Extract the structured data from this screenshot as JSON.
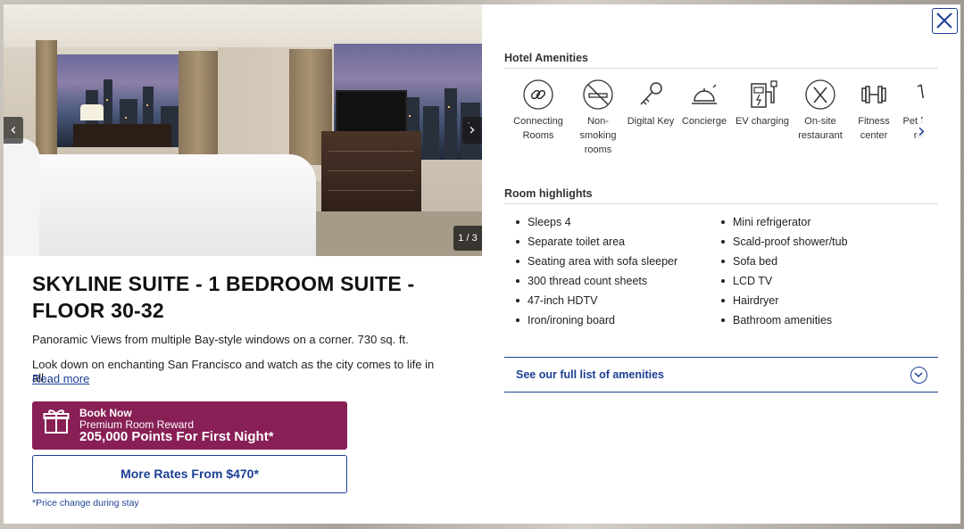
{
  "photo": {
    "counter": "1 / 3",
    "prev_glyph": "‹",
    "next_glyph": "›"
  },
  "room": {
    "title": "SKYLINE SUITE - 1 BEDROOM SUITE - FLOOR 30-32",
    "subtitle": "Panoramic Views from multiple Bay-style windows on a corner. 730 sq. ft.",
    "description": "Look down on enchanting San Francisco and watch as the city comes to life in all...",
    "read_more": "Read more"
  },
  "booking": {
    "line1": "Book Now",
    "line2": "Premium Room Reward",
    "line3": "205,000 Points For First Night*",
    "brand_color": "#882056"
  },
  "rates": {
    "label": "More Rates From $470*",
    "note": "*Price change during stay"
  },
  "amenities": {
    "heading": "Hotel Amenities",
    "items": [
      {
        "label": "Connecting Rooms",
        "icon": "link-icon"
      },
      {
        "label": "Non-smoking rooms",
        "icon": "no-smoking-icon"
      },
      {
        "label": "Digital Key",
        "icon": "key-icon"
      },
      {
        "label": "Concierge",
        "icon": "bell-icon"
      },
      {
        "label": "EV charging",
        "icon": "ev-charger-icon"
      },
      {
        "label": "On-site restaurant",
        "icon": "utensils-icon"
      },
      {
        "label": "Fitness center",
        "icon": "dumbbell-icon"
      },
      {
        "label": "Pet friendly rooms",
        "icon": "pet-icon"
      }
    ],
    "next_glyph": "›"
  },
  "highlights": {
    "heading": "Room highlights",
    "left": [
      "Sleeps 4",
      "Separate toilet area",
      "Seating area with sofa sleeper",
      "300 thread count sheets",
      "47-inch HDTV",
      "Iron/ironing board"
    ],
    "right": [
      "Mini refrigerator",
      "Scald-proof shower/tub",
      "Sofa bed",
      "LCD TV",
      "Hairdryer",
      "Bathroom amenities"
    ]
  },
  "see_all": {
    "label": "See our full list of amenities"
  },
  "accent_color": "#1c3f94"
}
